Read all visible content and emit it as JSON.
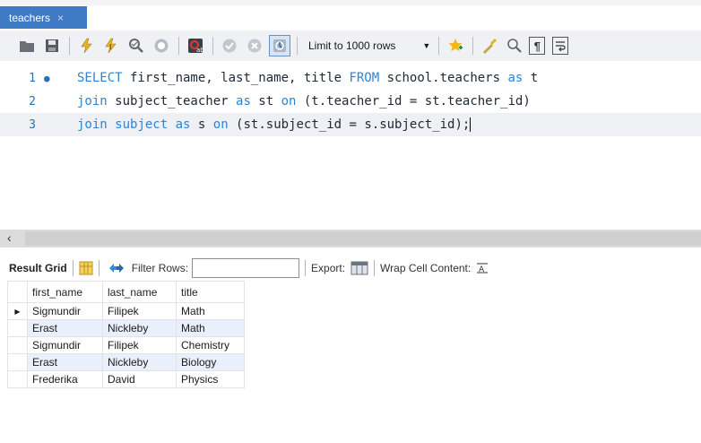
{
  "tab": {
    "title": "teachers",
    "close": "×"
  },
  "toolbar": {
    "limit_label": "Limit to 1000 rows",
    "icons": [
      "folder-open-icon",
      "save-icon",
      "execute-icon",
      "execute-current-icon",
      "explain-icon",
      "stop-icon",
      "toggle-autocommit-icon",
      "commit-icon",
      "rollback-icon",
      "toggle-error-icon",
      "bookmark-add-icon",
      "beautify-icon",
      "find-icon",
      "invisible-chars-icon",
      "word-wrap-icon"
    ]
  },
  "editor": {
    "lines": [
      {
        "number": "1",
        "marker": "●",
        "parts": [
          [
            "kw",
            "SELECT"
          ],
          [
            "t",
            " first_name, last_name, title "
          ],
          [
            "kw",
            "FROM"
          ],
          [
            "t",
            " school.teachers "
          ],
          [
            "kw",
            "as"
          ],
          [
            "t",
            " t"
          ]
        ]
      },
      {
        "number": "2",
        "marker": "",
        "parts": [
          [
            "kw",
            "join"
          ],
          [
            "t",
            " subject_teacher "
          ],
          [
            "kw",
            "as"
          ],
          [
            "t",
            " st "
          ],
          [
            "kw",
            "on"
          ],
          [
            "t",
            " (t.teacher_id = st.teacher_id)"
          ]
        ]
      },
      {
        "number": "3",
        "marker": "",
        "parts": [
          [
            "kw",
            "join"
          ],
          [
            "t",
            " "
          ],
          [
            "kw",
            "subject"
          ],
          [
            "t",
            " "
          ],
          [
            "kw",
            "as"
          ],
          [
            "t",
            " s "
          ],
          [
            "kw",
            "on"
          ],
          [
            "t",
            " (st.subject_id = s.subject_id);"
          ]
        ]
      }
    ]
  },
  "scrollbar": {
    "left_arrow": "‹"
  },
  "results": {
    "grid_label": "Result Grid",
    "filter_label": "Filter Rows:",
    "filter_value": "",
    "export_label": "Export:",
    "wrap_label": "Wrap Cell Content:",
    "columns": [
      "first_name",
      "last_name",
      "title"
    ],
    "rows": [
      [
        "Sigmundir",
        "Filipek",
        "Math"
      ],
      [
        "Erast",
        "Nickleby",
        "Math"
      ],
      [
        "Sigmundir",
        "Filipek",
        "Chemistry"
      ],
      [
        "Erast",
        "Nickleby",
        "Biology"
      ],
      [
        "Frederika",
        "David",
        "Physics"
      ]
    ],
    "selected_row_marker": "▶"
  },
  "colors": {
    "tab_bg": "#3e7bc4",
    "keyword": "#2a85d8",
    "alt_row": "#eaf0fb"
  }
}
